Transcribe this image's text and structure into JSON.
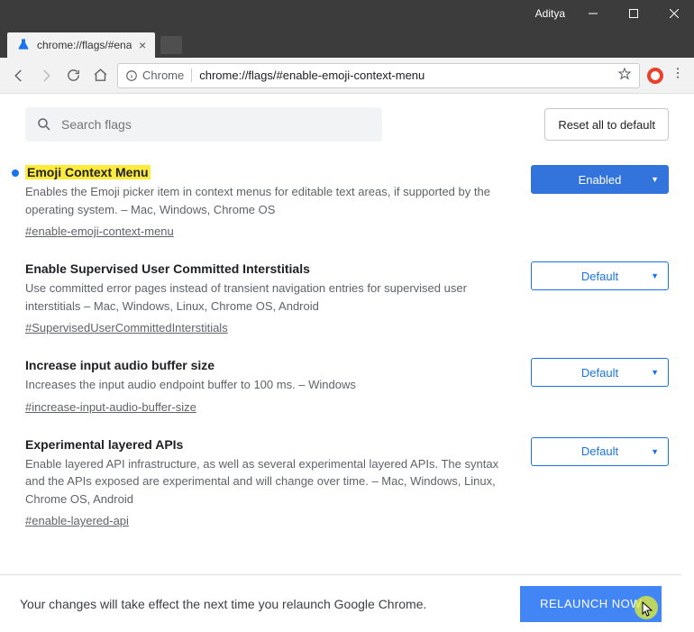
{
  "window": {
    "user": "Aditya"
  },
  "tab": {
    "title": "chrome://flags/#enable-e"
  },
  "address": {
    "chip": "Chrome",
    "url": "chrome://flags/#enable-emoji-context-menu"
  },
  "search": {
    "placeholder": "Search flags"
  },
  "reset_label": "Reset all to default",
  "flags": [
    {
      "title": "Emoji Context Menu",
      "highlight": true,
      "modified": true,
      "desc": "Enables the Emoji picker item in context menus for editable text areas, if supported by the operating system. – Mac, Windows, Chrome OS",
      "hash": "#enable-emoji-context-menu",
      "state": "Enabled",
      "filled": true
    },
    {
      "title": "Enable Supervised User Committed Interstitials",
      "highlight": false,
      "modified": false,
      "desc": "Use committed error pages instead of transient navigation entries for supervised user interstitials – Mac, Windows, Linux, Chrome OS, Android",
      "hash": "#SupervisedUserCommittedInterstitials",
      "state": "Default",
      "filled": false
    },
    {
      "title": "Increase input audio buffer size",
      "highlight": false,
      "modified": false,
      "desc": "Increases the input audio endpoint buffer to 100 ms. – Windows",
      "hash": "#increase-input-audio-buffer-size",
      "state": "Default",
      "filled": false
    },
    {
      "title": "Experimental layered APIs",
      "highlight": false,
      "modified": false,
      "desc": "Enable layered API infrastructure, as well as several experimental layered APIs. The syntax and the APIs exposed are experimental and will change over time. – Mac, Windows, Linux, Chrome OS, Android",
      "hash": "#enable-layered-api",
      "state": "Default",
      "filled": false
    }
  ],
  "footer": {
    "msg": "Your changes will take effect the next time you relaunch Google Chrome.",
    "relaunch": "RELAUNCH NOW"
  }
}
